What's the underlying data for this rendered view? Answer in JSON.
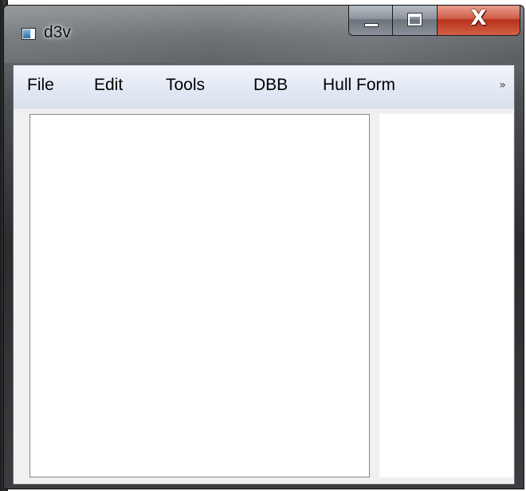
{
  "window": {
    "title": "d3v",
    "controls": {
      "minimize": "minimize-icon",
      "maximize": "maximize-icon",
      "close": "close-icon",
      "close_glyph": "X"
    }
  },
  "menubar": {
    "items": [
      {
        "label": "File"
      },
      {
        "label": "Edit"
      },
      {
        "label": "Tools"
      },
      {
        "label": "DBB"
      },
      {
        "label": "Hull Form"
      }
    ],
    "overflow": "»"
  },
  "colors": {
    "close_button": "#c8432b",
    "menubar": "#e3e9f4",
    "client_background": "#f0f0f0",
    "panel_background": "#ffffff"
  }
}
